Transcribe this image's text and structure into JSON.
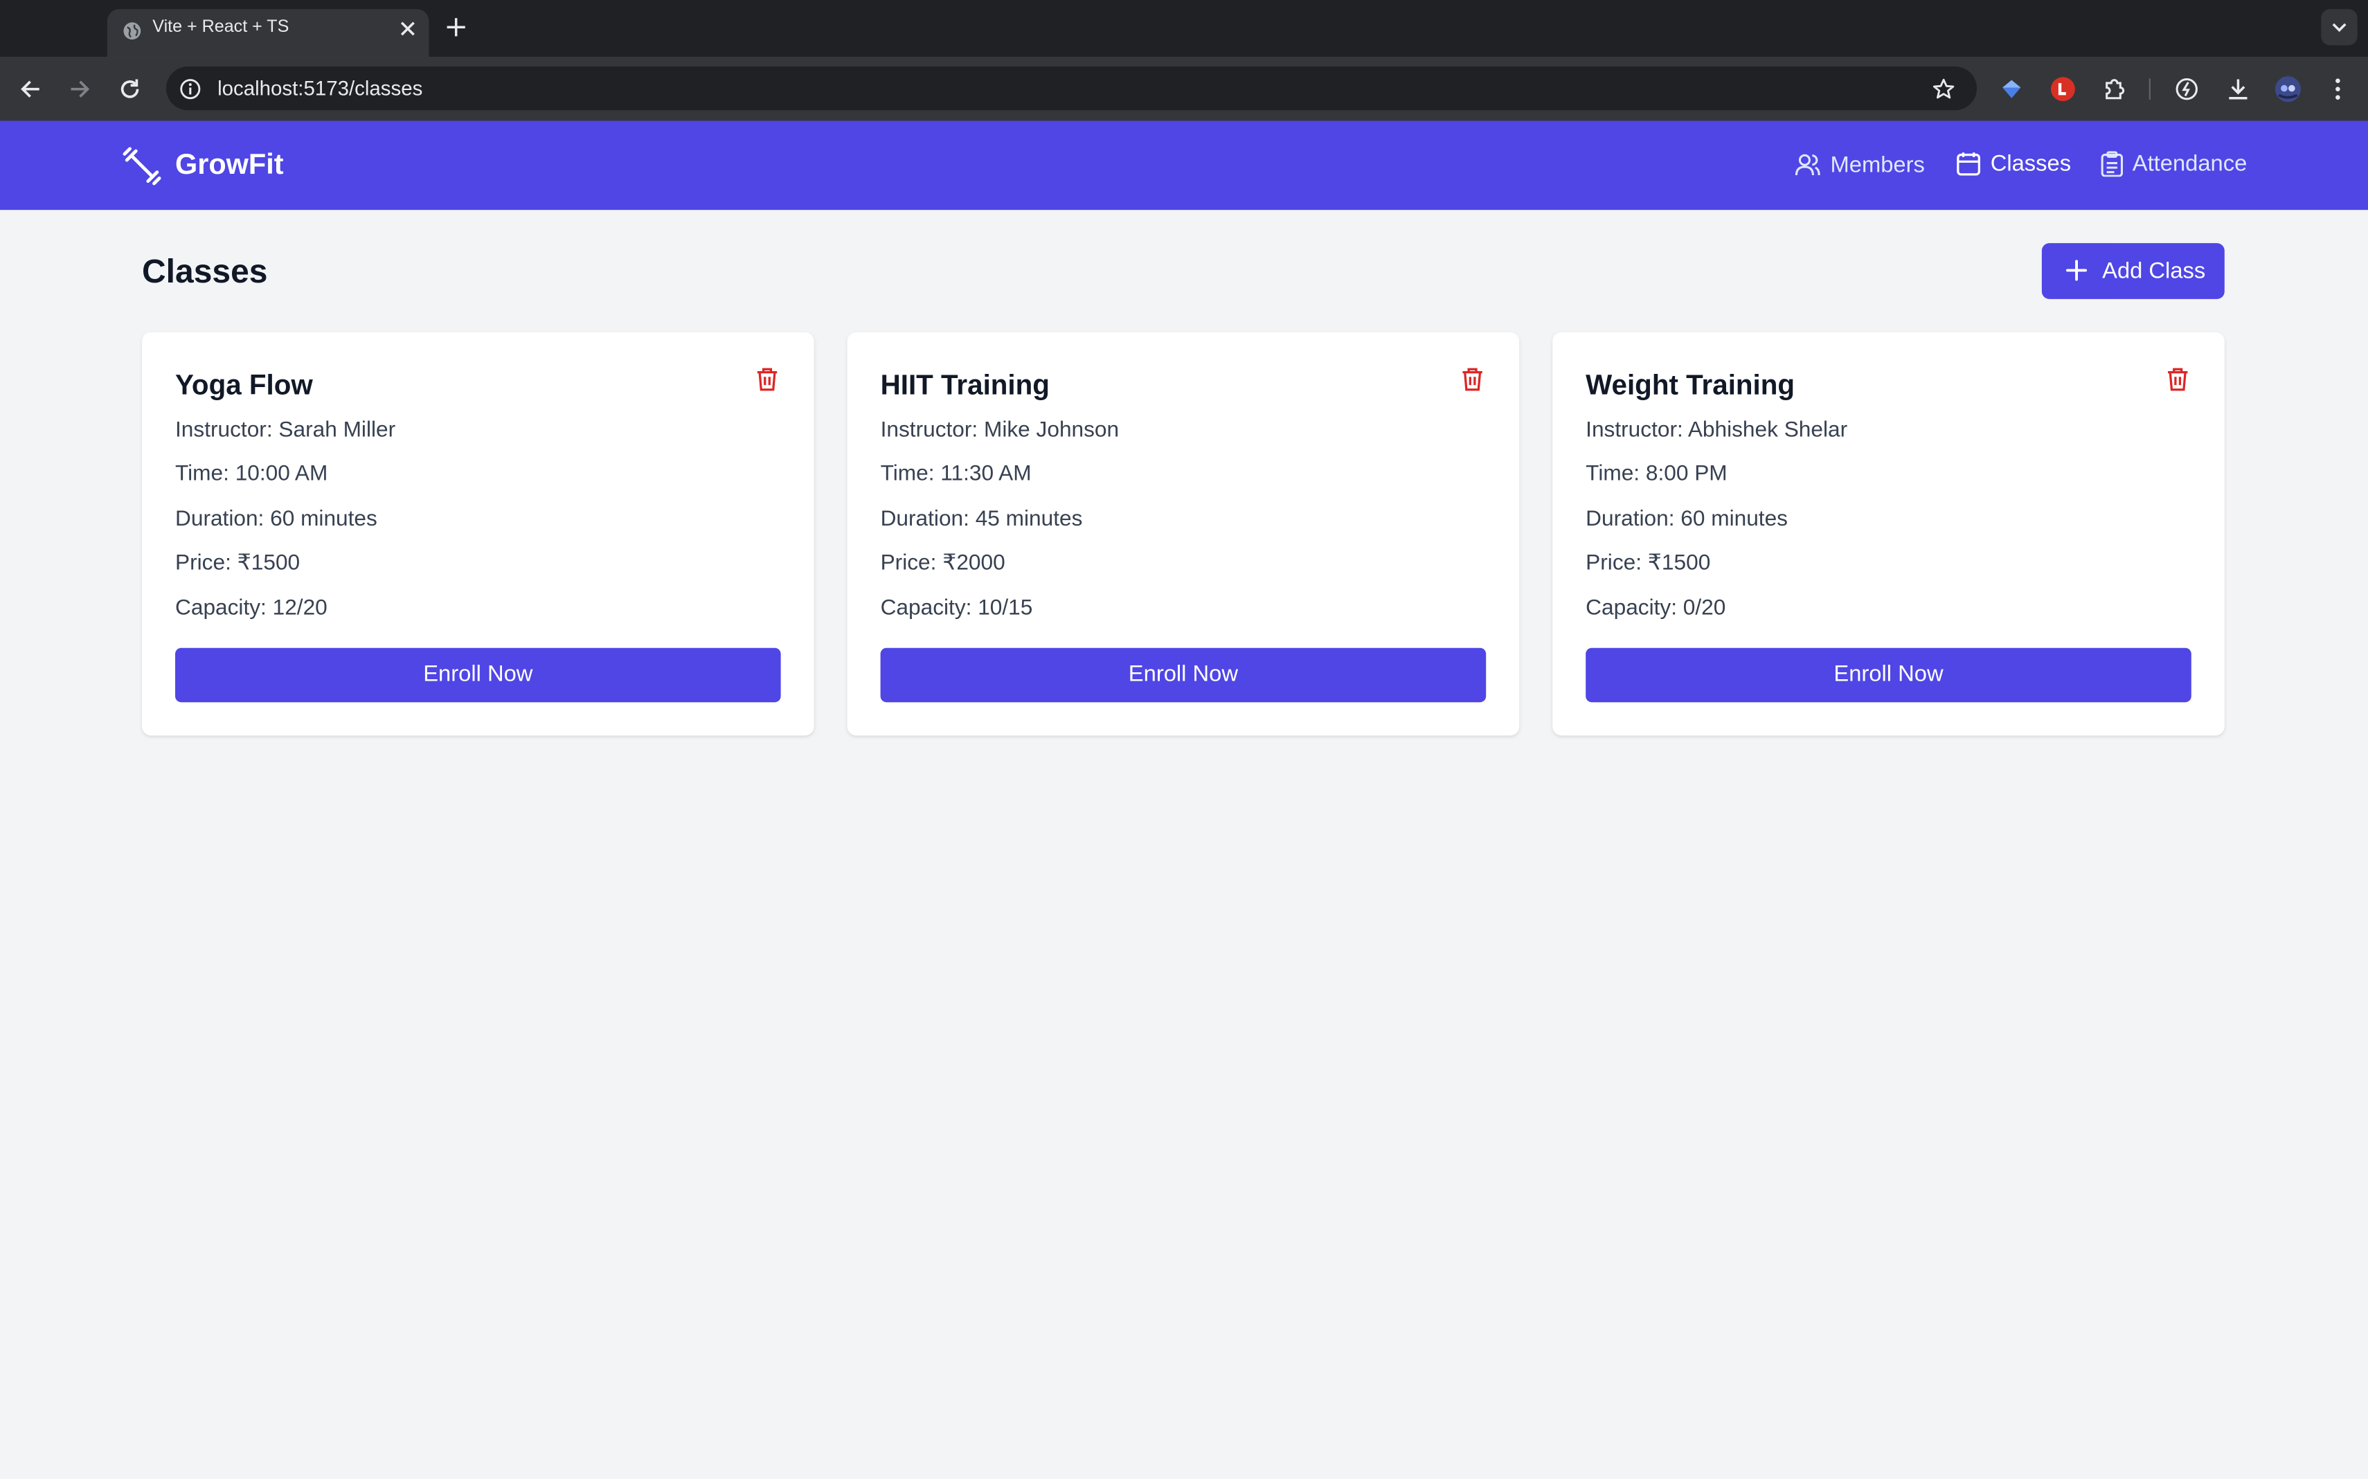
{
  "browser": {
    "tab_title": "Vite + React + TS",
    "url": "localhost:5173/classes"
  },
  "app": {
    "brand": "GrowFit",
    "nav": [
      {
        "label": "Members",
        "icon": "users-icon",
        "active": false
      },
      {
        "label": "Classes",
        "icon": "calendar-icon",
        "active": true
      },
      {
        "label": "Attendance",
        "icon": "clipboard-icon",
        "active": false
      }
    ],
    "accent_color": "#4f46e5",
    "danger_color": "#dc2626"
  },
  "page": {
    "title": "Classes",
    "add_button_label": "Add Class"
  },
  "classes": [
    {
      "name": "Yoga Flow",
      "instructor": "Instructor: Sarah Miller",
      "time": "Time: 10:00 AM",
      "duration": "Duration: 60 minutes",
      "price": "Price: ₹1500",
      "capacity": "Capacity: 12/20",
      "enroll_label": "Enroll Now"
    },
    {
      "name": "HIIT Training",
      "instructor": "Instructor: Mike Johnson",
      "time": "Time: 11:30 AM",
      "duration": "Duration: 45 minutes",
      "price": "Price: ₹2000",
      "capacity": "Capacity: 10/15",
      "enroll_label": "Enroll Now"
    },
    {
      "name": "Weight Training",
      "instructor": "Instructor: Abhishek Shelar",
      "time": "Time: 8:00 PM",
      "duration": "Duration: 60 minutes",
      "price": "Price: ₹1500",
      "capacity": "Capacity: 0/20",
      "enroll_label": "Enroll Now"
    }
  ]
}
